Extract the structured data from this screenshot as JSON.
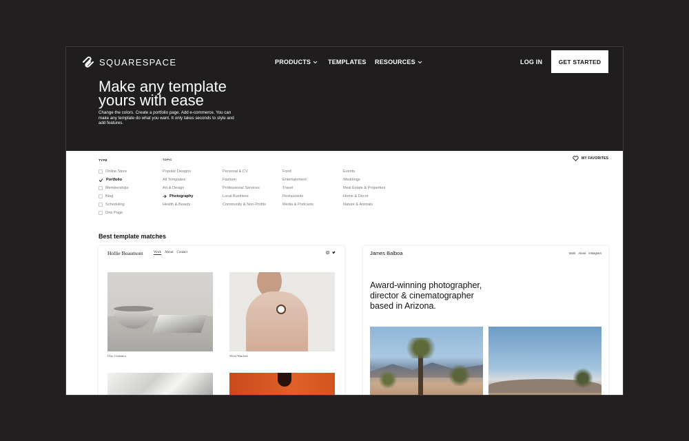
{
  "header": {
    "brand": "SQUARESPACE",
    "nav": [
      "PRODUCTS",
      "TEMPLATES",
      "RESOURCES"
    ],
    "login": "LOG IN",
    "cta": "GET STARTED"
  },
  "hero": {
    "title": "Make any template yours with ease",
    "subtitle": "Change the colors. Create a portfolio page. Add e-commerce. You can make any template do what you want. It only takes seconds to style and add features."
  },
  "filters": {
    "type_label": "TYPE",
    "topic_label": "TOPIC",
    "favorites": "MY FAVORITES",
    "type_items": [
      {
        "label": "Online Store",
        "checked": false
      },
      {
        "label": "Portfolio",
        "checked": true
      },
      {
        "label": "Memberships",
        "checked": false
      },
      {
        "label": "Blog",
        "checked": false
      },
      {
        "label": "Scheduling",
        "checked": false
      },
      {
        "label": "One Page",
        "checked": false
      }
    ],
    "topic_col1": [
      "Popular Designs",
      "All Templates",
      "Art & Design",
      "Photography",
      "Health & Beauty"
    ],
    "topic_col2": [
      "Personal & CV",
      "Fashion",
      "Professional Services",
      "Local Business",
      "Community & Non-Profits"
    ],
    "topic_col3": [
      "Food",
      "Entertainment",
      "Travel",
      "Restaurants",
      "Media & Podcasts"
    ],
    "topic_col4": [
      "Events",
      "Weddings",
      "Real Estate & Properties",
      "Home & Decor",
      "Nature & Animals"
    ],
    "active_topic": "Photography"
  },
  "results": {
    "heading": "Best template matches",
    "card1": {
      "name": "Hollie Beaumont",
      "nav": [
        "Work",
        "About",
        "Contact"
      ],
      "captions": [
        "Clay Ceramics",
        "Wrist Watches"
      ]
    },
    "card2": {
      "name": "James Balboa",
      "nav": [
        "Work",
        "About",
        "Instagram"
      ],
      "headline": "Award-winning photographer, director & cinematographer based in Arizona."
    }
  }
}
